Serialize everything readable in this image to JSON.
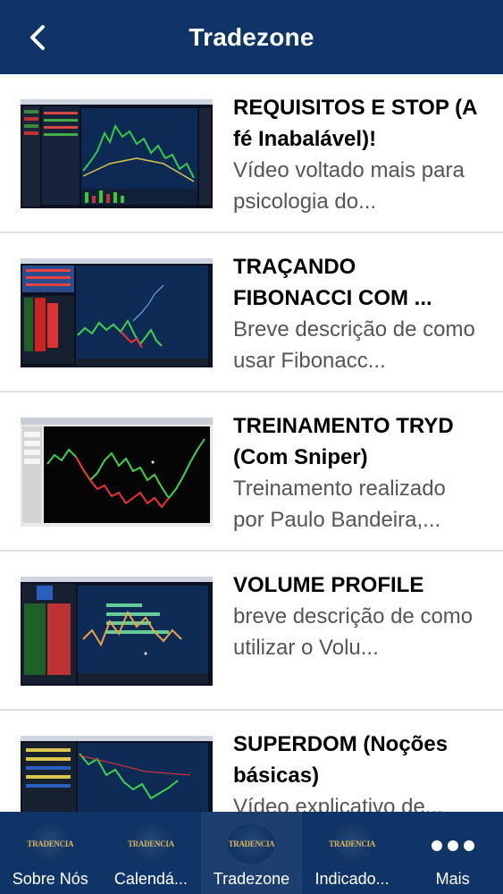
{
  "header": {
    "title": "Tradezone"
  },
  "items": [
    {
      "title": "REQUISITOS E STOP (A fé Inabalável)!",
      "description": "Vídeo voltado mais para psicologia do..."
    },
    {
      "title": "TRAÇANDO FIBONACCI COM ...",
      "description": "Breve descrição de como usar Fibonacc..."
    },
    {
      "title": "TREINAMENTO TRYD (Com Sniper)",
      "description": "Treinamento realizado por Paulo Bandeira,..."
    },
    {
      "title": "VOLUME PROFILE",
      "description": "breve descrição de como utilizar o Volu..."
    },
    {
      "title": "SUPERDOM (Noções básicas)",
      "description": "Vídeo explicativo de..."
    }
  ],
  "tabs": [
    {
      "label": "Sobre Nós",
      "logo": "TRADENCIA"
    },
    {
      "label": "Calendá...",
      "logo": "TRADENCIA"
    },
    {
      "label": "Tradezone",
      "logo": "TRADENCIA"
    },
    {
      "label": "Indicado...",
      "logo": "TRADENCIA"
    },
    {
      "label": "Mais"
    }
  ]
}
